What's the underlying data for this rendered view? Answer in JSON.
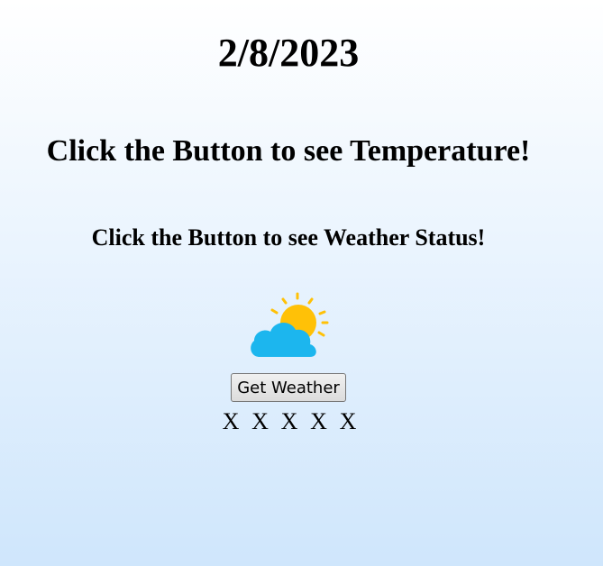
{
  "date_text": "2/8/2023",
  "temperature_text": "Click the Button to see Temperature!",
  "weather_status_text": "Click the Button to see Weather Status!",
  "weather_icon": "partly-cloudy-icon",
  "button_label": "Get Weather",
  "marks": [
    "X",
    "X",
    "X",
    "X",
    "X"
  ],
  "colors": {
    "background_top": "#ffffff",
    "background_bottom": "#cfe6fc",
    "cloud": "#1cb6ee",
    "sun": "#ffc107"
  }
}
